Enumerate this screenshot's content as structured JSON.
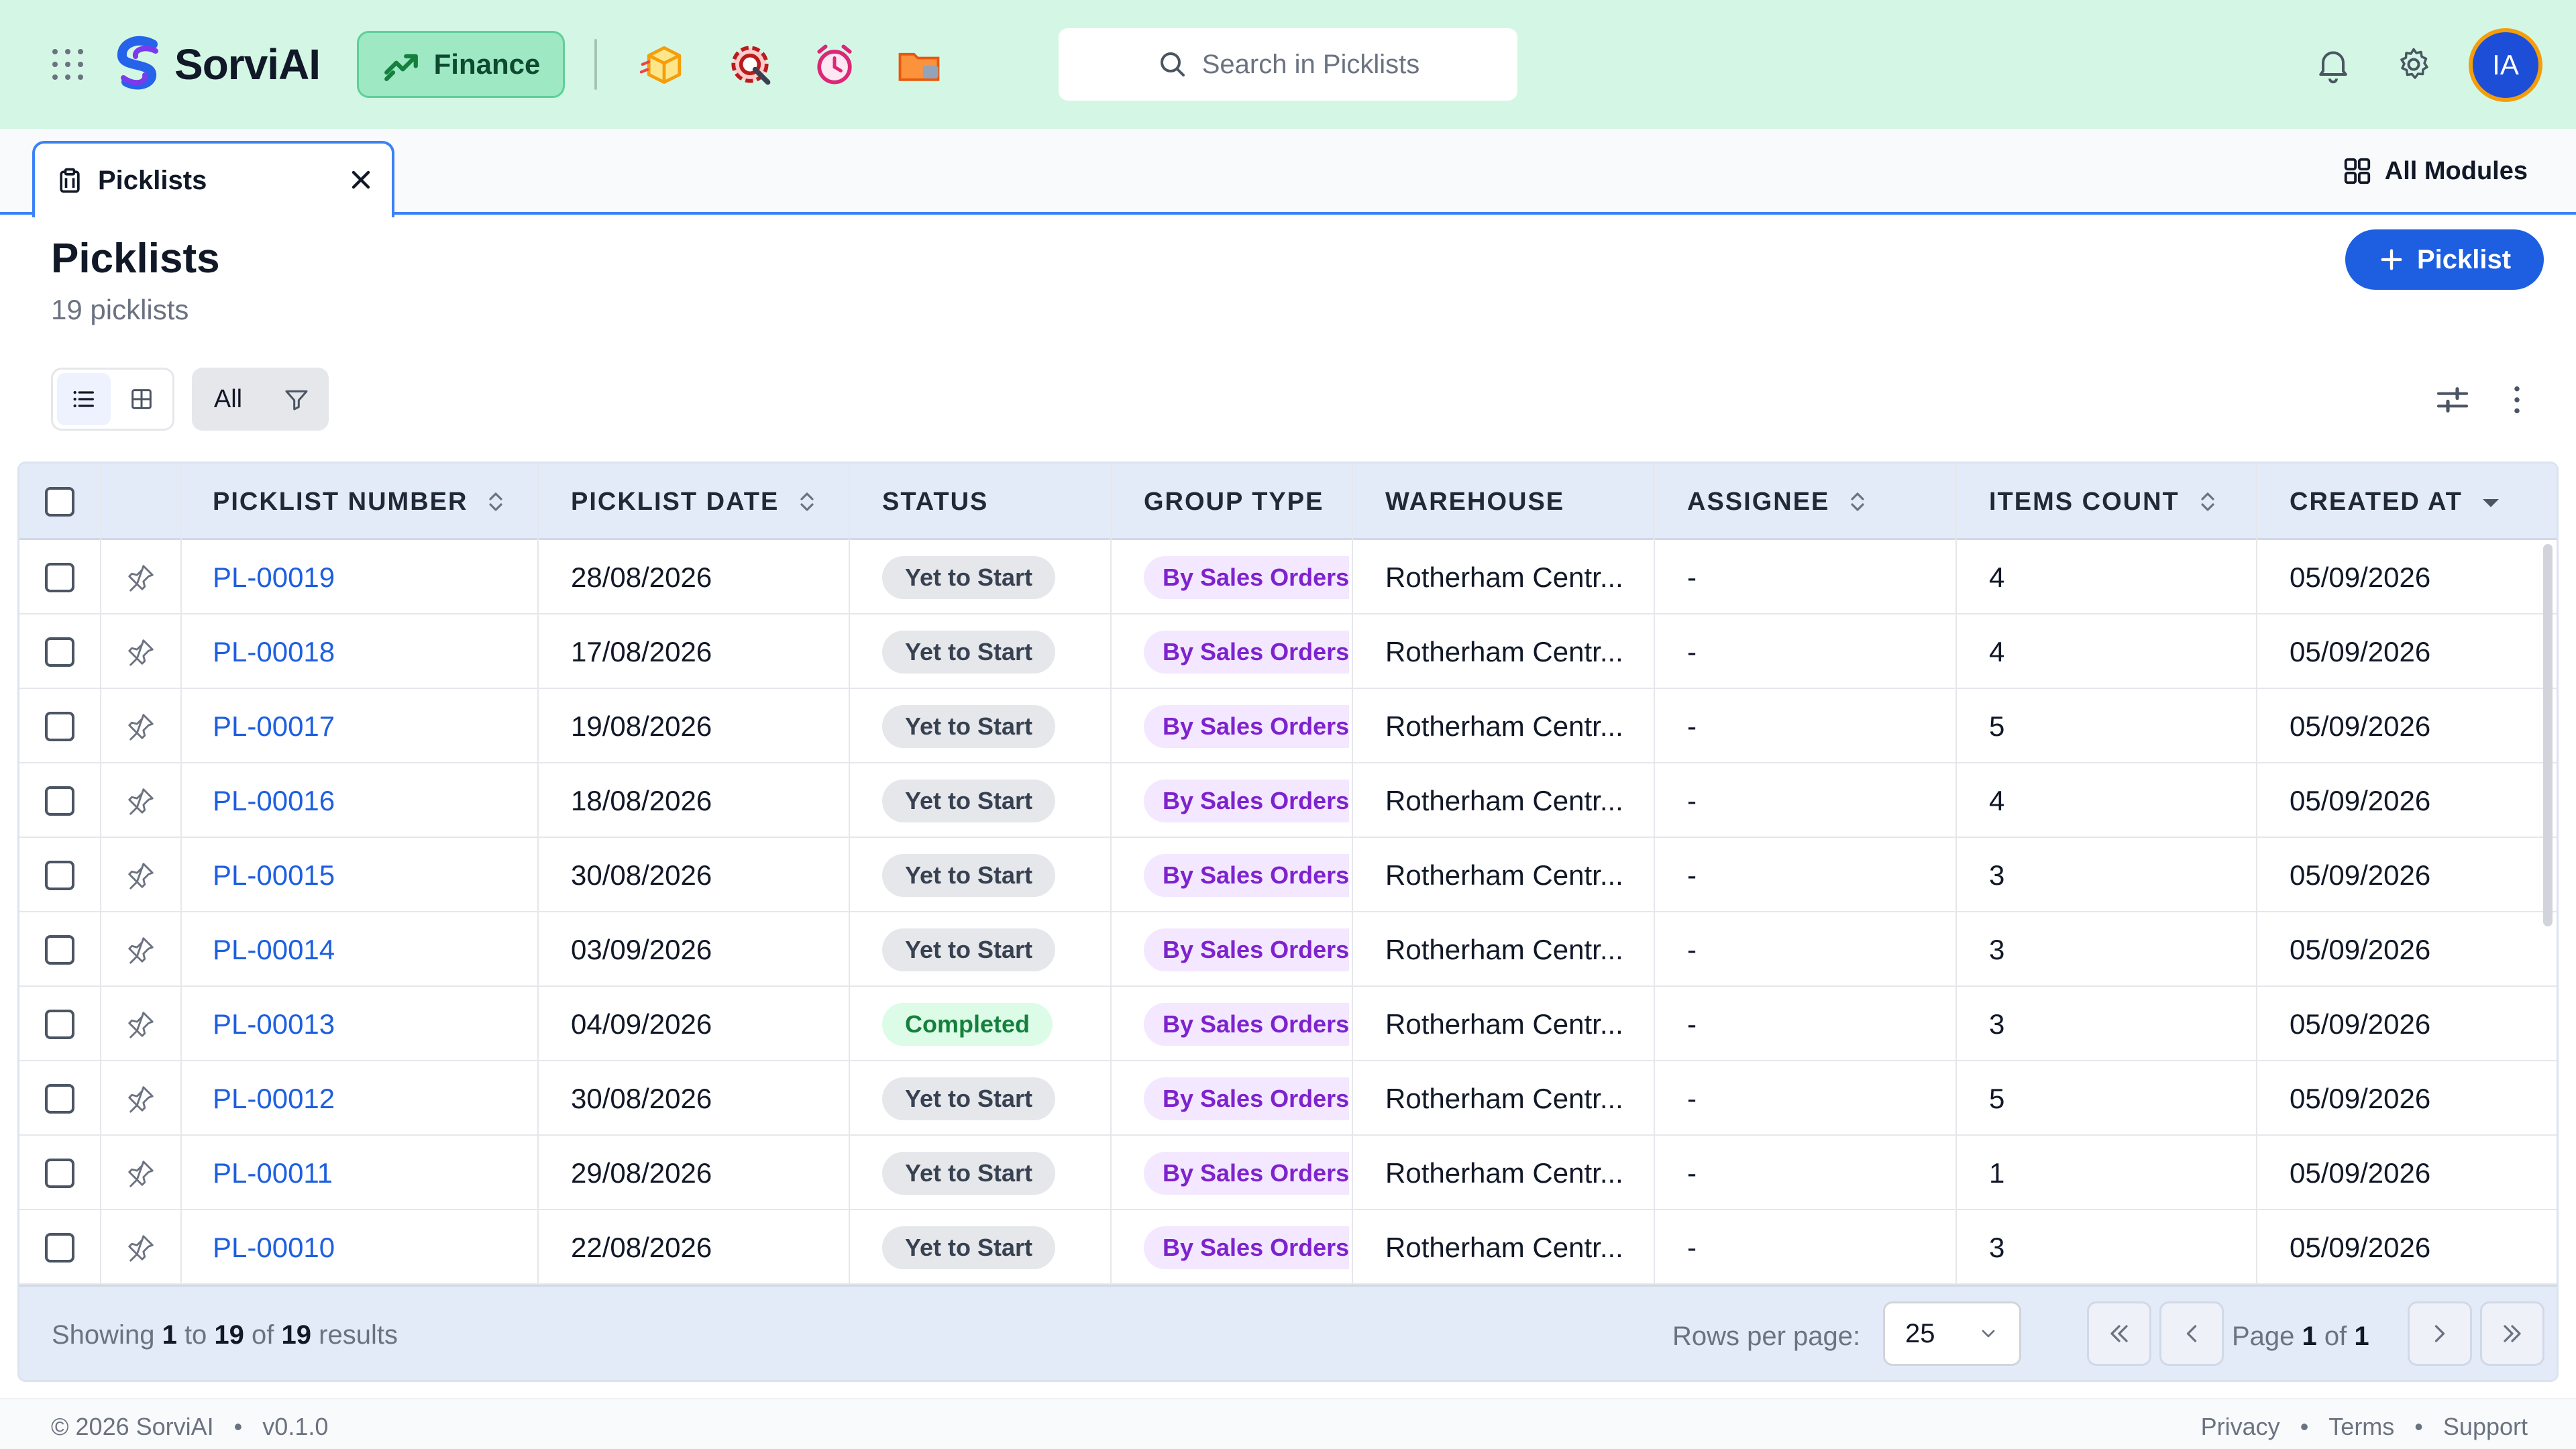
{
  "brand": {
    "name": "SorviAI"
  },
  "module_chip": {
    "label": "Finance"
  },
  "search": {
    "placeholder": "Search in Picklists"
  },
  "user": {
    "initials": "IA"
  },
  "tab": {
    "label": "Picklists"
  },
  "all_modules": {
    "label": "All Modules"
  },
  "page": {
    "title": "Picklists",
    "subtitle": "19 picklists",
    "new_button": "Picklist"
  },
  "filter": {
    "all_label": "All"
  },
  "table": {
    "columns": [
      "PICKLIST NUMBER",
      "PICKLIST DATE",
      "STATUS",
      "GROUP TYPE",
      "WAREHOUSE",
      "ASSIGNEE",
      "ITEMS COUNT",
      "CREATED AT"
    ],
    "rows": [
      {
        "number": "PL-00019",
        "date": "28/08/2026",
        "status": "Yet to Start",
        "group": "By Sales Orders",
        "warehouse": "Rotherham Centr...",
        "assignee": "-",
        "items": "4",
        "created": "05/09/2026"
      },
      {
        "number": "PL-00018",
        "date": "17/08/2026",
        "status": "Yet to Start",
        "group": "By Sales Orders",
        "warehouse": "Rotherham Centr...",
        "assignee": "-",
        "items": "4",
        "created": "05/09/2026"
      },
      {
        "number": "PL-00017",
        "date": "19/08/2026",
        "status": "Yet to Start",
        "group": "By Sales Orders",
        "warehouse": "Rotherham Centr...",
        "assignee": "-",
        "items": "5",
        "created": "05/09/2026"
      },
      {
        "number": "PL-00016",
        "date": "18/08/2026",
        "status": "Yet to Start",
        "group": "By Sales Orders",
        "warehouse": "Rotherham Centr...",
        "assignee": "-",
        "items": "4",
        "created": "05/09/2026"
      },
      {
        "number": "PL-00015",
        "date": "30/08/2026",
        "status": "Yet to Start",
        "group": "By Sales Orders",
        "warehouse": "Rotherham Centr...",
        "assignee": "-",
        "items": "3",
        "created": "05/09/2026"
      },
      {
        "number": "PL-00014",
        "date": "03/09/2026",
        "status": "Yet to Start",
        "group": "By Sales Orders",
        "warehouse": "Rotherham Centr...",
        "assignee": "-",
        "items": "3",
        "created": "05/09/2026"
      },
      {
        "number": "PL-00013",
        "date": "04/09/2026",
        "status": "Completed",
        "group": "By Sales Orders",
        "warehouse": "Rotherham Centr...",
        "assignee": "-",
        "items": "3",
        "created": "05/09/2026"
      },
      {
        "number": "PL-00012",
        "date": "30/08/2026",
        "status": "Yet to Start",
        "group": "By Sales Orders",
        "warehouse": "Rotherham Centr...",
        "assignee": "-",
        "items": "5",
        "created": "05/09/2026"
      },
      {
        "number": "PL-00011",
        "date": "29/08/2026",
        "status": "Yet to Start",
        "group": "By Sales Orders",
        "warehouse": "Rotherham Centr...",
        "assignee": "-",
        "items": "1",
        "created": "05/09/2026"
      },
      {
        "number": "PL-00010",
        "date": "22/08/2026",
        "status": "Yet to Start",
        "group": "By Sales Orders",
        "warehouse": "Rotherham Centr...",
        "assignee": "-",
        "items": "3",
        "created": "05/09/2026"
      }
    ]
  },
  "pagination": {
    "showing_prefix": "Showing",
    "from": "1",
    "to_word": "to",
    "to": "19",
    "of_word": "of",
    "total": "19",
    "results_word": "results",
    "rows_per_page_label": "Rows per page:",
    "rows_per_page": "25",
    "page_word": "Page",
    "page": "1",
    "page_of_word": "of",
    "page_total": "1"
  },
  "footer": {
    "copyright": "© 2026 SorviAI",
    "version": "v0.1.0",
    "links": [
      "Privacy",
      "Terms",
      "Support"
    ],
    "separator": "•"
  },
  "colors": {
    "topbar": "#d4f7e5",
    "accent": "#1d5fe0",
    "module_chip": "#9ee8c4",
    "completed": "#15803d",
    "group_badge": "#7e22ce"
  },
  "icons": [
    "apps-grid-icon",
    "trend-up-icon",
    "search-icon",
    "bell-icon",
    "gear-icon",
    "clipboard-icon",
    "close-icon",
    "modules-grid-icon",
    "plus-icon",
    "list-view-icon",
    "grid-view-icon",
    "filter-icon",
    "sliders-icon",
    "more-vertical-icon",
    "pin-icon",
    "sort-icon",
    "sort-desc-icon",
    "chevron-down-icon",
    "chevrons-left-icon",
    "chevron-left-icon",
    "chevron-right-icon",
    "chevrons-right-icon"
  ]
}
